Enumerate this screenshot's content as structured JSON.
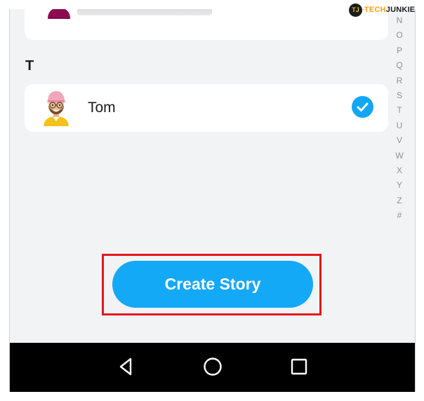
{
  "logo": {
    "mark": "TJ",
    "brand_part1": "TECH",
    "brand_part2": "JUNKIE"
  },
  "contacts": {
    "section_letter": "T",
    "top_item": {
      "avatar_icon": "bitmoji-silhouette-icon",
      "selected": false
    },
    "tom": {
      "name": "Tom",
      "avatar_icon": "bitmoji-avatar-icon",
      "selected": true
    }
  },
  "alphabet_index": [
    "N",
    "O",
    "P",
    "Q",
    "R",
    "S",
    "T",
    "U",
    "V",
    "W",
    "X",
    "Y",
    "Z",
    "#"
  ],
  "create_story_label": "Create Story",
  "navbar": {
    "back_icon": "back-triangle-icon",
    "home_icon": "home-circle-icon",
    "recent_icon": "recent-apps-square-icon"
  },
  "colors": {
    "accent": "#14a9f6",
    "highlight": "#e0191e",
    "background": "#f2f3f5",
    "navbar": "#000000"
  }
}
